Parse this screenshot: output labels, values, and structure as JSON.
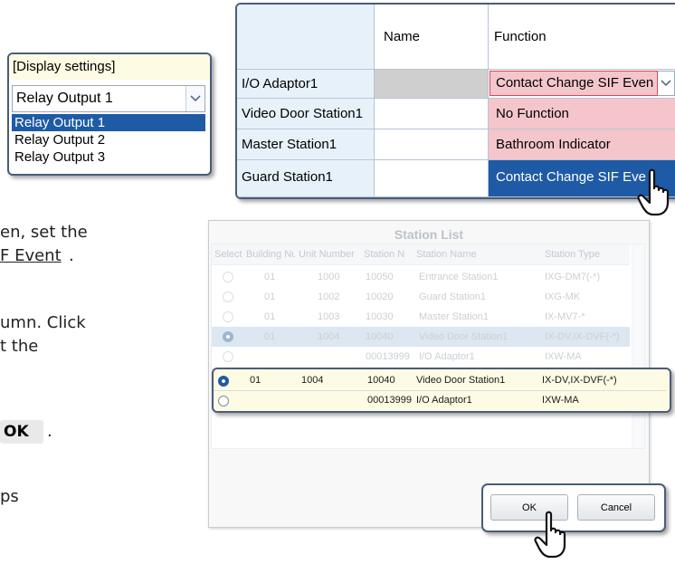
{
  "body_text": {
    "line1": "en, set the",
    "line2": "F Event",
    "line2_period": ".",
    "line3": "umn. Click",
    "line4": "t the",
    "line5_ok": "OK",
    "line5_period": ".",
    "line6": "ps"
  },
  "display_settings": {
    "title": "[Display settings]",
    "selected_value": "Relay Output 1",
    "options": [
      "Relay Output 1",
      "Relay Output 2",
      "Relay Output 3"
    ]
  },
  "function_table": {
    "columns": [
      "Name",
      "Function"
    ],
    "rows": [
      {
        "label": "I/O Adaptor1",
        "function": "Contact Change SIF Even"
      },
      {
        "label": "Video Door Station1"
      },
      {
        "label": "Master Station1"
      },
      {
        "label": "Guard Station1"
      }
    ],
    "dropdown_options": [
      "No Function",
      "Bathroom Indicator",
      "Contact Change SIF Eve"
    ]
  },
  "station_list": {
    "title": "Station List",
    "columns": [
      "Select",
      "Building Nu",
      "Unit Number",
      "Station Nu",
      "Station Name",
      "Station Type"
    ],
    "rows": [
      {
        "building": "01",
        "unit": "1000",
        "station_no": "10050",
        "name": "Entrance Station1",
        "type": "IXG-DM7(-*)"
      },
      {
        "building": "01",
        "unit": "1002",
        "station_no": "10020",
        "name": "Guard Station1",
        "type": "IXG-MK"
      },
      {
        "building": "01",
        "unit": "1003",
        "station_no": "10030",
        "name": "Master Station1",
        "type": "IX-MV7-*"
      },
      {
        "building": "01",
        "unit": "1004",
        "station_no": "10040",
        "name": "Video Door Station1",
        "type": "IX-DV,IX-DVF(-*)"
      },
      {
        "building": "",
        "unit": "",
        "station_no": "00013999",
        "name": "I/O Adaptor1",
        "type": "IXW-MA"
      }
    ],
    "zoom_rows": [
      {
        "building": "01",
        "unit": "1004",
        "station_no": "10040",
        "name": "Video Door Station1",
        "type": "IX-DV,IX-DVF(-*)"
      },
      {
        "building": "",
        "unit": "",
        "station_no": "00013999",
        "name": "I/O Adaptor1",
        "type": "IXW-MA"
      }
    ],
    "ok_label": "OK",
    "cancel_label": "Cancel"
  },
  "colors": {
    "selection_blue": "#1f5aa6",
    "function_pink": "#f4c6cc",
    "label_cell_blue": "#e6f1fa",
    "callout_border": "#4a5c7a",
    "callout_fill": "#fdfbe3"
  },
  "icons": [
    "chevron-down-icon",
    "pointer-hand-icon"
  ]
}
